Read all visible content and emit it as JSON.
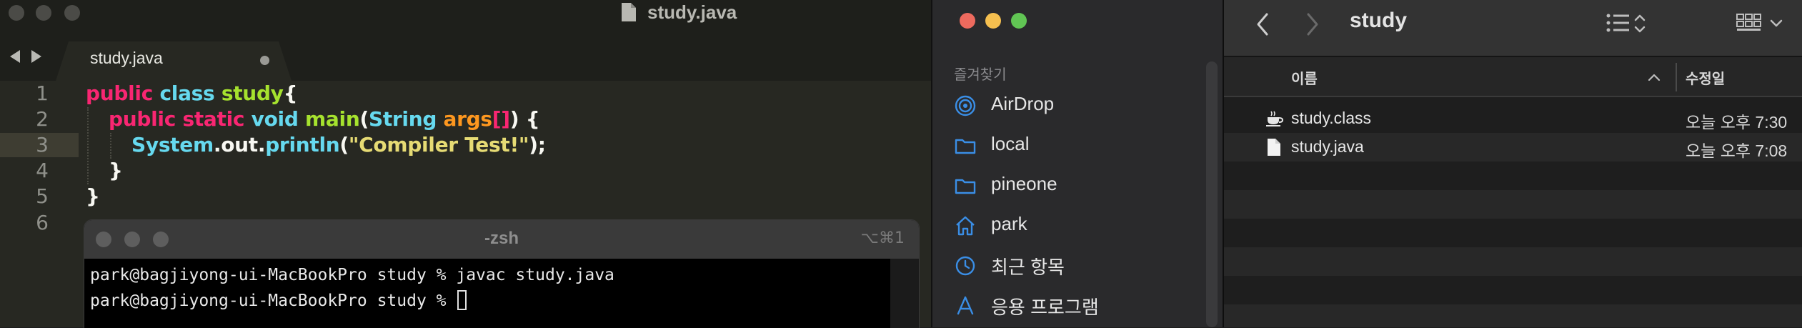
{
  "editor": {
    "window_title": "study.java",
    "tab_label": "study.java",
    "line_numbers": [
      "1",
      "2",
      "3",
      "4",
      "5",
      "6"
    ],
    "code": {
      "l1": [
        "public",
        "class",
        "study",
        "{"
      ],
      "l2": [
        "public",
        "static",
        "void",
        "main",
        "(",
        "String",
        "args",
        "[]",
        ") {"
      ],
      "l3": [
        "System",
        ".",
        "out",
        ".",
        "println",
        "(",
        "\"Compiler Test!\"",
        ");"
      ],
      "l4": [
        "}"
      ],
      "l5": [
        "}"
      ]
    }
  },
  "terminal": {
    "title": "-zsh",
    "shortcut": "⌥⌘1",
    "lines": [
      "park@bagjiyong-ui-MacBookPro study % javac study.java",
      "park@bagjiyong-ui-MacBookPro study % "
    ]
  },
  "finder": {
    "sidebar": {
      "section_label": "즐겨찾기",
      "items": [
        {
          "label": "AirDrop",
          "icon": "airdrop-icon"
        },
        {
          "label": "local",
          "icon": "folder-icon"
        },
        {
          "label": "pineone",
          "icon": "folder-icon"
        },
        {
          "label": "park",
          "icon": "home-icon"
        },
        {
          "label": "최근 항목",
          "icon": "clock-icon"
        },
        {
          "label": "응용 프로그램",
          "icon": "applications-icon"
        }
      ]
    },
    "title": "study",
    "columns": {
      "name": "이름",
      "modified": "수정일"
    },
    "files": [
      {
        "name": "study.class",
        "modified": "오늘 오후 7:30",
        "icon": "java-class-icon"
      },
      {
        "name": "study.java",
        "modified": "오늘 오후 7:08",
        "icon": "document-icon"
      }
    ],
    "colors": {
      "accent": "#3a8ee6",
      "stripe": "#282828"
    }
  }
}
